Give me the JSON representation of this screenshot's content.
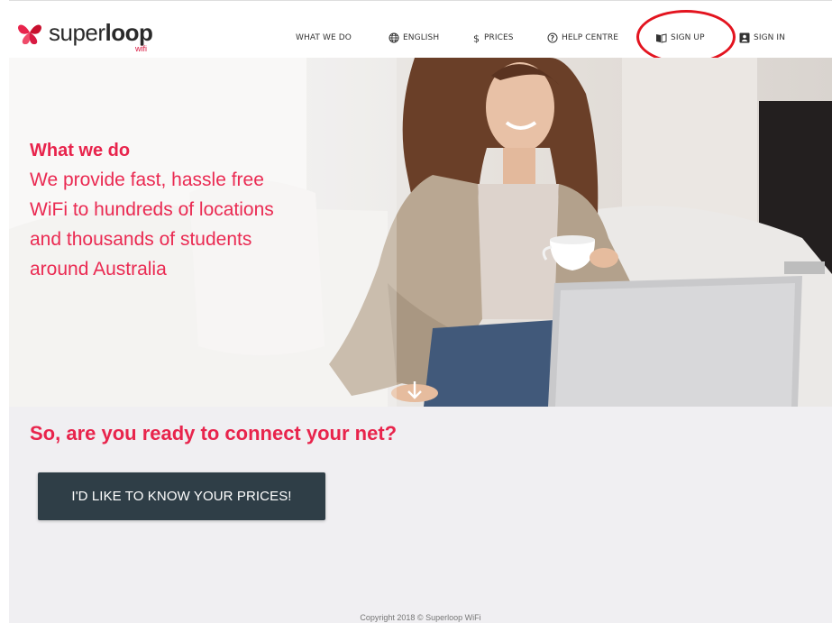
{
  "brand": {
    "name_light": "super",
    "name_bold": "loop",
    "sub": "wifi",
    "color": "#e8244c"
  },
  "nav": {
    "what_we_do": "WHAT WE DO",
    "language": "ENGLISH",
    "prices": "PRICES",
    "help_centre": "HELP CENTRE",
    "sign_up": "SIGN UP",
    "sign_in": "SIGN IN",
    "icons": {
      "language": "globe-icon",
      "prices": "dollar-icon",
      "help_centre": "question-circle-icon",
      "sign_up": "book-icon",
      "sign_in": "id-card-icon"
    },
    "highlight_color": "#e3141f"
  },
  "hero": {
    "title": "What we do",
    "lines": [
      "We provide fast, hassle free",
      "WiFi to hundreds of locations",
      "and thousands of students",
      "around Australia"
    ],
    "scroll_icon": "arrow-down-icon"
  },
  "cta": {
    "heading": "So, are you ready to connect your net?",
    "button_label": "I'D LIKE TO KNOW YOUR PRICES!",
    "button_color": "#2f3e47"
  },
  "footer": {
    "copyright": "Copyright 2018 © Superloop WiFi"
  }
}
